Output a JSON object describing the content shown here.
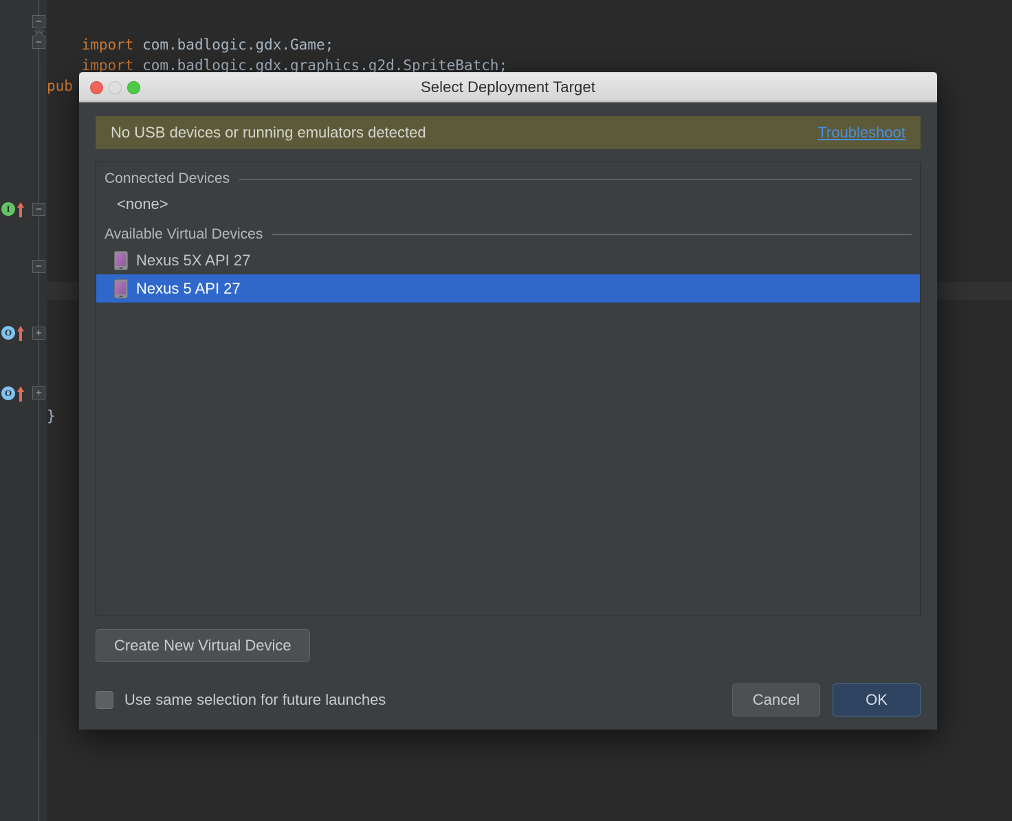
{
  "editor": {
    "code_lines": [
      {
        "keyword": "import",
        "rest": " com.badlogic.gdx.Game;"
      },
      {
        "keyword": "import",
        "rest": " com.badlogic.gdx.graphics.g2d.SpriteBatch;"
      }
    ],
    "partial_line": "pub",
    "closing_brace": "}",
    "gutter_marks": [
      {
        "badge": "I",
        "kind": "implementing-method"
      },
      {
        "badge": "O",
        "kind": "overriding-method"
      },
      {
        "badge": "O",
        "kind": "overriding-method"
      }
    ],
    "fold_markers": [
      "-",
      "-",
      "+",
      "+"
    ],
    "colors": {
      "background": "#2b2b2b",
      "gutter": "#313335",
      "keyword": "#cc7832",
      "identifier": "#a9b7c6"
    }
  },
  "dialog": {
    "title": "Select Deployment Target",
    "window_controls": {
      "close": "close-button",
      "minimize": "minimize-button",
      "zoom": "zoom-button"
    },
    "warning": {
      "message": "No USB devices or running emulators detected",
      "link_label": "Troubleshoot",
      "background": "#5c5a38",
      "link_color": "#4a8fe0"
    },
    "sections": [
      {
        "label": "Connected Devices",
        "empty_value": "<none>",
        "devices": []
      },
      {
        "label": "Available Virtual Devices",
        "devices": [
          {
            "name": "Nexus 5X API 27",
            "icon": "virtual-device-icon",
            "selected": false
          },
          {
            "name": "Nexus 5 API 27",
            "icon": "virtual-device-icon",
            "selected": true
          }
        ]
      }
    ],
    "create_button_label": "Create New Virtual Device",
    "checkbox": {
      "label": "Use same selection for future launches",
      "checked": false
    },
    "cancel_label": "Cancel",
    "ok_label": "OK",
    "colors": {
      "panel": "#3c3f41",
      "selection": "#2f68ca",
      "ok_button": "#2f4460"
    }
  }
}
